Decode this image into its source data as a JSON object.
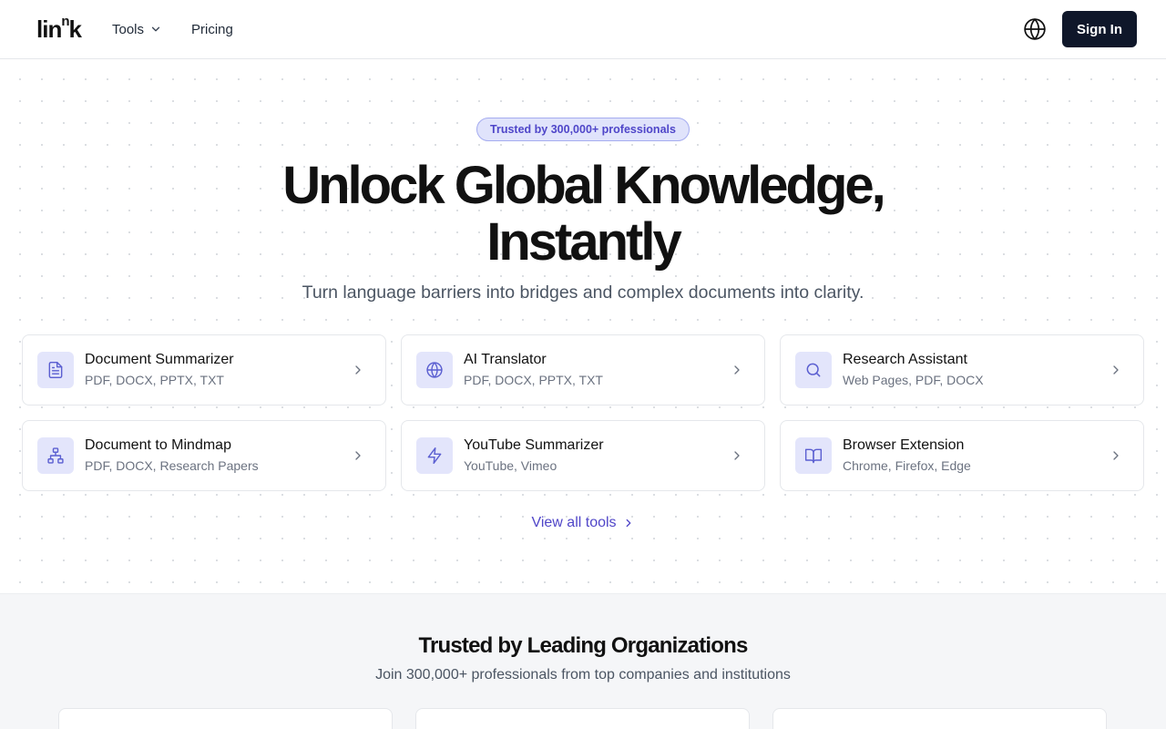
{
  "header": {
    "logo_main": "lin",
    "logo_sup": "n",
    "logo_end": "k",
    "nav": [
      {
        "label": "Tools"
      },
      {
        "label": "Pricing"
      }
    ],
    "signin_label": "Sign In",
    "icons": {
      "language": "globe-icon",
      "dropdown": "chevron-down-icon"
    }
  },
  "hero": {
    "badge": "Trusted by 300,000+ professionals",
    "title_line1": "Unlock Global Knowledge,",
    "title_line2": "Instantly",
    "subtitle": "Turn language barriers into bridges and complex documents into clarity.",
    "tools": [
      {
        "name": "Document Summarizer",
        "formats": "PDF, DOCX, PPTX, TXT",
        "icon": "document-icon"
      },
      {
        "name": "AI Translator",
        "formats": "PDF, DOCX, PPTX, TXT",
        "icon": "globe-icon"
      },
      {
        "name": "Research Assistant",
        "formats": "Web Pages, PDF, DOCX",
        "icon": "search-icon"
      },
      {
        "name": "Document to Mindmap",
        "formats": "PDF, DOCX, Research Papers",
        "icon": "mindmap-icon"
      },
      {
        "name": "YouTube Summarizer",
        "formats": "YouTube, Vimeo",
        "icon": "lightning-icon"
      },
      {
        "name": "Browser Extension",
        "formats": "Chrome, Firefox, Edge",
        "icon": "book-icon"
      }
    ],
    "view_all": "View all tools"
  },
  "trusted": {
    "title": "Trusted by Leading Organizations",
    "subtitle": "Join 300,000+ professionals from top companies and institutions"
  },
  "colors": {
    "accent": "#5046c8",
    "icon_bg": "#e3e5fb",
    "signin_bg": "#0f172a",
    "badge_bg": "#e0e3fb"
  }
}
